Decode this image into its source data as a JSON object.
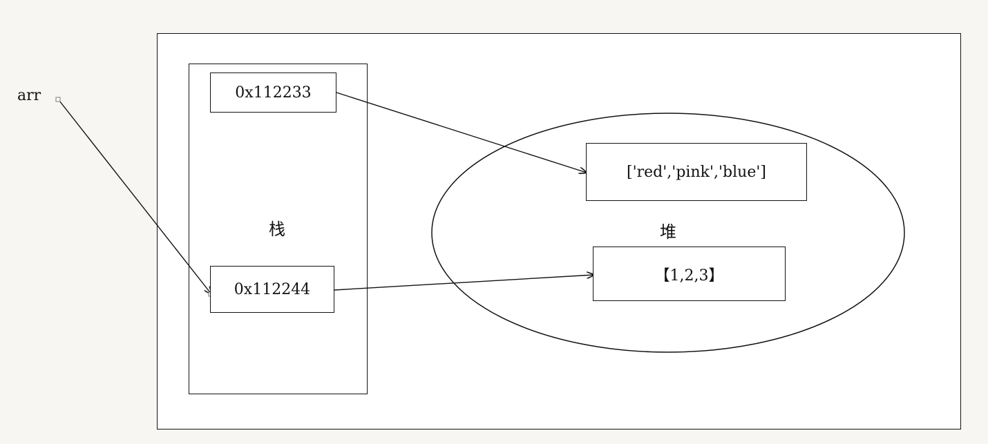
{
  "diagram": {
    "variable_label": "arr",
    "stack": {
      "label": "栈",
      "addresses": [
        "0x112233",
        "0x112244"
      ]
    },
    "heap": {
      "label": "堆",
      "objects": [
        "['red','pink','blue']",
        "【1,2,3】"
      ]
    },
    "connections": [
      {
        "from": "arr",
        "to": "0x112244"
      },
      {
        "from": "0x112233",
        "to": "['red','pink','blue']"
      },
      {
        "from": "0x112244",
        "to": "【1,2,3】"
      }
    ]
  }
}
